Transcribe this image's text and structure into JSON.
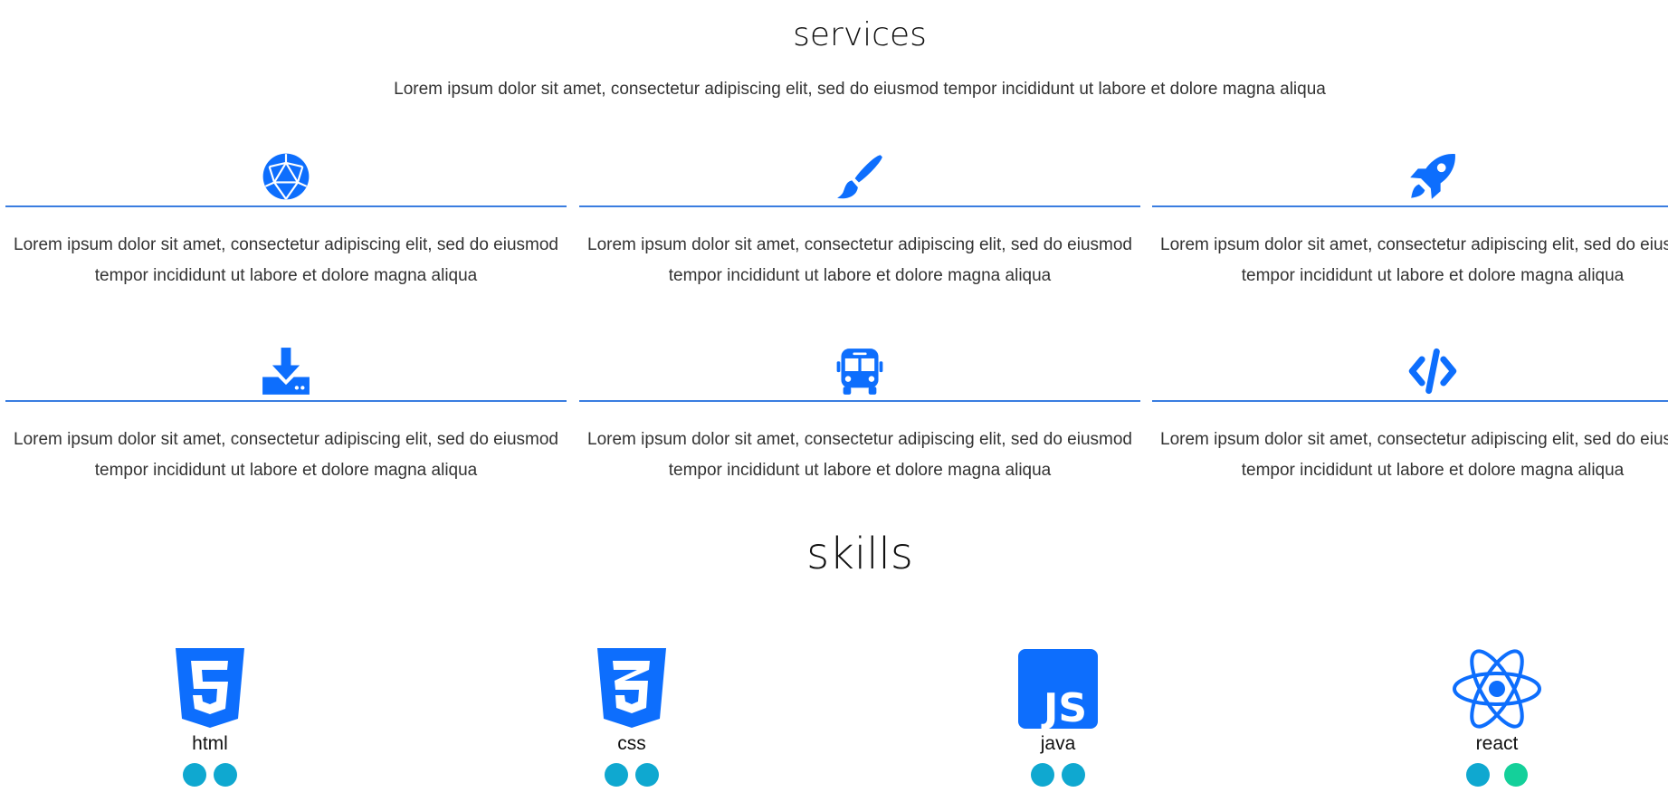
{
  "colors": {
    "accent": "#0d6efd",
    "divider": "#3a7de0",
    "dot_primary": "#0fa8d0",
    "dot_secondary": "#14d09a"
  },
  "services": {
    "title": "services",
    "subtitle": "Lorem ipsum dolor sit amet, consectetur adipiscing elit, sed do eiusmod tempor incididunt ut labore et dolore magna aliqua",
    "items": [
      {
        "icon": "dice-d20-icon",
        "text": "Lorem ipsum dolor sit amet, consectetur adipiscing elit, sed do eiusmod tempor incididunt ut labore et dolore magna aliqua"
      },
      {
        "icon": "paint-brush-icon",
        "text": "Lorem ipsum dolor sit amet, consectetur adipiscing elit, sed do eiusmod tempor incididunt ut labore et dolore magna aliqua"
      },
      {
        "icon": "rocket-icon",
        "text": "Lorem ipsum dolor sit amet, consectetur adipiscing elit, sed do eiusmod tempor incididunt ut labore et dolore magna aliqua"
      },
      {
        "icon": "download-icon",
        "text": "Lorem ipsum dolor sit amet, consectetur adipiscing elit, sed do eiusmod tempor incididunt ut labore et dolore magna aliqua"
      },
      {
        "icon": "bus-icon",
        "text": "Lorem ipsum dolor sit amet, consectetur adipiscing elit, sed do eiusmod tempor incididunt ut labore et dolore magna aliqua"
      },
      {
        "icon": "code-icon",
        "text": "Lorem ipsum dolor sit amet, consectetur adipiscing elit, sed do eiusmod tempor incididunt ut labore et dolore magna aliqua"
      }
    ]
  },
  "skills": {
    "title": "skills",
    "items": [
      {
        "name": "html",
        "icon": "html5-icon",
        "dots": [
          "#0fa8d0",
          "#0fa8d0"
        ]
      },
      {
        "name": "css",
        "icon": "css3-icon",
        "dots": [
          "#0fa8d0",
          "#0fa8d0"
        ]
      },
      {
        "name": "java",
        "icon": "js-icon",
        "dots": [
          "#0fa8d0",
          "#0fa8d0"
        ]
      },
      {
        "name": "react",
        "icon": "react-icon",
        "dots": [
          "#0fa8d0",
          "#14d09a"
        ]
      }
    ]
  }
}
